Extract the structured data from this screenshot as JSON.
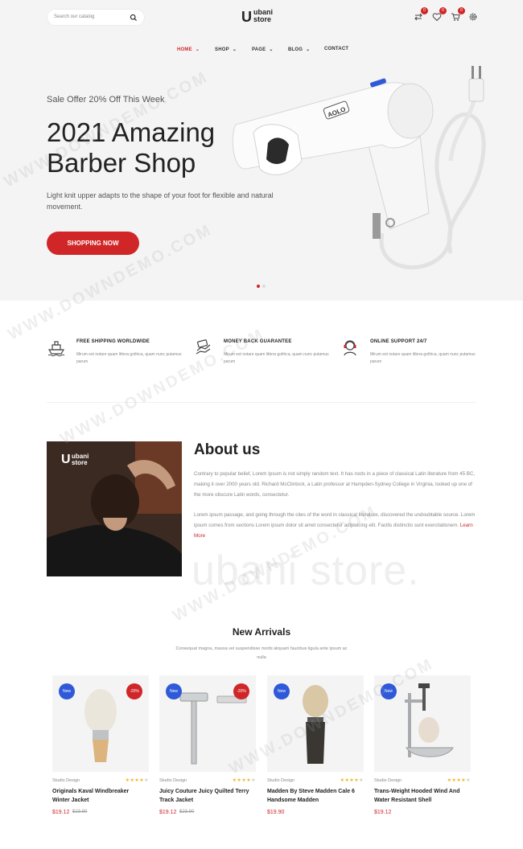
{
  "header": {
    "search_placeholder": "Search our catalog",
    "logo_mark": "U",
    "logo_line1": "ubani",
    "logo_line2": "store",
    "compare_count": "0",
    "wishlist_count": "0",
    "cart_count": "0"
  },
  "nav": {
    "items": [
      {
        "label": "HOME",
        "caret": "⌄"
      },
      {
        "label": "SHOP",
        "caret": "⌄"
      },
      {
        "label": "PAGE",
        "caret": "⌄"
      },
      {
        "label": "BLOG",
        "caret": "⌄"
      },
      {
        "label": "CONTACT",
        "caret": ""
      }
    ]
  },
  "hero": {
    "subtitle": "Sale Offer 20% Off This Week",
    "title_line1": "2021 Amazing",
    "title_line2": "Barber Shop",
    "description": "Light knit upper adapts to the shape of your foot for flexible and natural movement.",
    "button": "SHOPPING NOW",
    "dryer_brand": "AOLO"
  },
  "features": [
    {
      "title": "FREE SHIPPING WORLDWIDE",
      "desc": "Mirum est notare quam littera gothica, quam nunc putamus parum",
      "icon": "ship-icon"
    },
    {
      "title": "MONEY BACK GUARANTEE",
      "desc": "Mirum est notare quam littera gothica, quam nunc putamus parum",
      "icon": "money-back-icon"
    },
    {
      "title": "ONLINE SUPPORT 24/7",
      "desc": "Mirum est notare quam littera gothica, quam nunc putamus parum",
      "icon": "support-icon"
    }
  ],
  "about": {
    "title": "About us",
    "p1": "Contrary to popular belief, Lorem Ipsum is not simply random text. It has roots in a piece of classical Latin literature from 45 BC, making it over 2000 years old. Richard McClintock, a Latin professor at Hampden-Sydney College in Virginia, looked up one of the more obscure Latin words, consectetur.",
    "p2": "Lorem ipsum passage, and going through the cites of the word in classical literature, discovered the undoubtable source. Lorem ipsum comes from sections Lorem ipsum dolor sit amet consectetur adipisicing elit. Facilis distinctio sunt exercitationem.",
    "learn_more": "Learn More",
    "image_logo_line1": "ubani",
    "image_logo_line2": "store",
    "watermark": "ubani store."
  },
  "arrivals": {
    "title": "New Arrivals",
    "desc": "Consequat magna, massa vel suspendisse morbi aliquam faucibus ligula ante ipsum ac nulla",
    "products": [
      {
        "new": "New",
        "sale": "-20%",
        "brand": "Studio Design",
        "name": "Originals Kaval Windbreaker Winter Jacket",
        "price": "$19.12",
        "old_price": "$23.90",
        "rating": 4
      },
      {
        "new": "New",
        "sale": "-20%",
        "brand": "Studio Design",
        "name": "Juicy Couture Juicy Quilted Terry Track Jacket",
        "price": "$19.12",
        "old_price": "$23.90",
        "rating": 4
      },
      {
        "new": "New",
        "sale": "",
        "brand": "Studio Design",
        "name": "Madden By Steve Madden Cale 6 Handsome Madden",
        "price": "$19.90",
        "old_price": "",
        "rating": 4
      },
      {
        "new": "New",
        "sale": "",
        "brand": "Studio Design",
        "name": "Trans-Weight Hooded Wind And Water Resistant Shell",
        "price": "$19.12",
        "old_price": "",
        "rating": 4
      }
    ]
  },
  "watermark": "WWW.DOWNDEMO.COM",
  "colors": {
    "accent": "#d02628",
    "new_badge": "#2e59d9",
    "hero_bg": "#f4f4f4"
  }
}
